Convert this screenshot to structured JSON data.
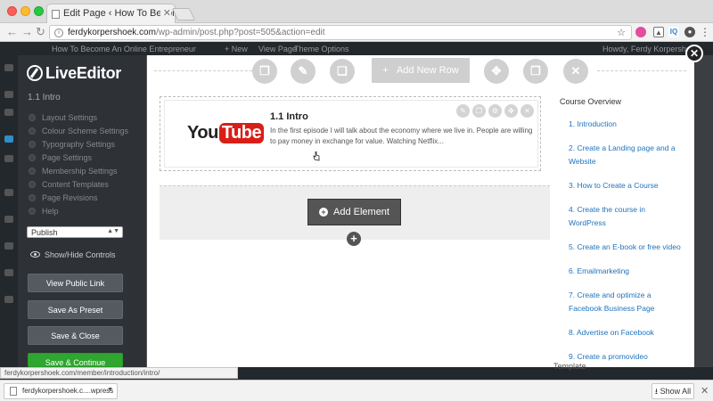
{
  "browser": {
    "tab_title": "Edit Page ‹ How To Become An",
    "url_host": "ferdykorpershoek.com",
    "url_path": "/wp-admin/post.php?post=505&action=edit",
    "status_url": "ferdykorpershoek.com/member/introduction/intro/"
  },
  "wp_adminbar": {
    "site_name": "How To Become An Online Entrepreneur",
    "new_label": "New",
    "view_page": "View Page",
    "theme_options": "Theme Options",
    "howdy": "Howdy, Ferdy Korpershoek"
  },
  "sidebar": {
    "logo": "LiveEditor",
    "page_title": "1.1 Intro",
    "menu": [
      "Layout Settings",
      "Colour Scheme Settings",
      "Typography Settings",
      "Page Settings",
      "Membership Settings",
      "Content Templates",
      "Page Revisions",
      "Help"
    ],
    "status_value": "Publish",
    "show_hide": "Show/Hide Controls",
    "buttons": {
      "view_public_link": "View Public Link",
      "save_as_preset": "Save As Preset",
      "save_close": "Save & Close",
      "save_continue": "Save & Continue"
    },
    "accent_green": "#2fa62f"
  },
  "editor": {
    "add_new_row": "Add New Row",
    "element_title": "1.1 Intro",
    "element_desc": "In the first episode I will talk about the economy where we live in. People are willing to pay money in exchange for value. Watching Netflix...",
    "logo_you": "You",
    "logo_tube": "Tube",
    "add_element": "Add Element"
  },
  "course": {
    "title": "Course Overview",
    "items": [
      "1. Introduction",
      "2. Create a Landing page and a Website",
      "3. How to Create a Course",
      "4. Create the course in WordPress",
      "5. Create an E-book or free video",
      "6. Emailmarketing",
      "7. Create and optimize a Facebook Business Page",
      "8. Advertise on Facebook",
      "9. Create a promovideo"
    ]
  },
  "background": {
    "template_text": "Template"
  },
  "downloads": {
    "file_name": "ferdykorpershoek.c....wpress",
    "show_all": "Show All"
  }
}
